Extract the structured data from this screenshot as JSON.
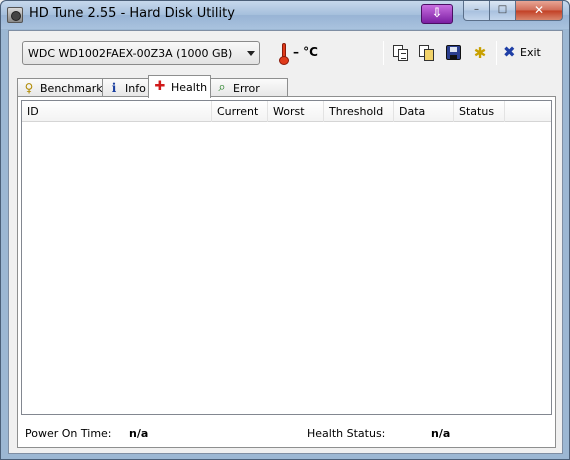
{
  "window": {
    "title": "HD Tune 2.55 - Hard Disk Utility",
    "download_icon": "download-arrow-icon",
    "minimize_glyph": "–",
    "maximize_glyph": "□",
    "close_glyph": "✕"
  },
  "toolbar": {
    "drive_selected": "WDC WD1002FAEX-00Z3A (1000 GB)",
    "temperature": "– °C",
    "icons": [
      "copy-text-icon",
      "copy-screenshot-icon",
      "save-icon",
      "options-icon"
    ],
    "exit_label": "Exit"
  },
  "tabs": [
    {
      "label": "Benchmark",
      "icon": "benchmark-icon",
      "glyph": "♀"
    },
    {
      "label": "Info",
      "icon": "info-icon",
      "glyph": "i"
    },
    {
      "label": "Health",
      "icon": "health-cross-icon",
      "glyph": "✚"
    },
    {
      "label": "Error Scan",
      "icon": "magnifier-icon",
      "glyph": "⌕"
    }
  ],
  "active_tab": "Health",
  "health_table": {
    "columns": [
      "ID",
      "Current",
      "Worst",
      "Threshold",
      "Data",
      "Status"
    ],
    "rows": []
  },
  "status": {
    "power_on_label": "Power On Time:",
    "power_on_value": "n/a",
    "health_label": "Health Status:",
    "health_value": "n/a"
  },
  "colors": {
    "title_bar": "#a5bfdc",
    "close_button": "#c23f24",
    "download_button": "#7b1fa2",
    "health_icon": "#d01a1a"
  }
}
